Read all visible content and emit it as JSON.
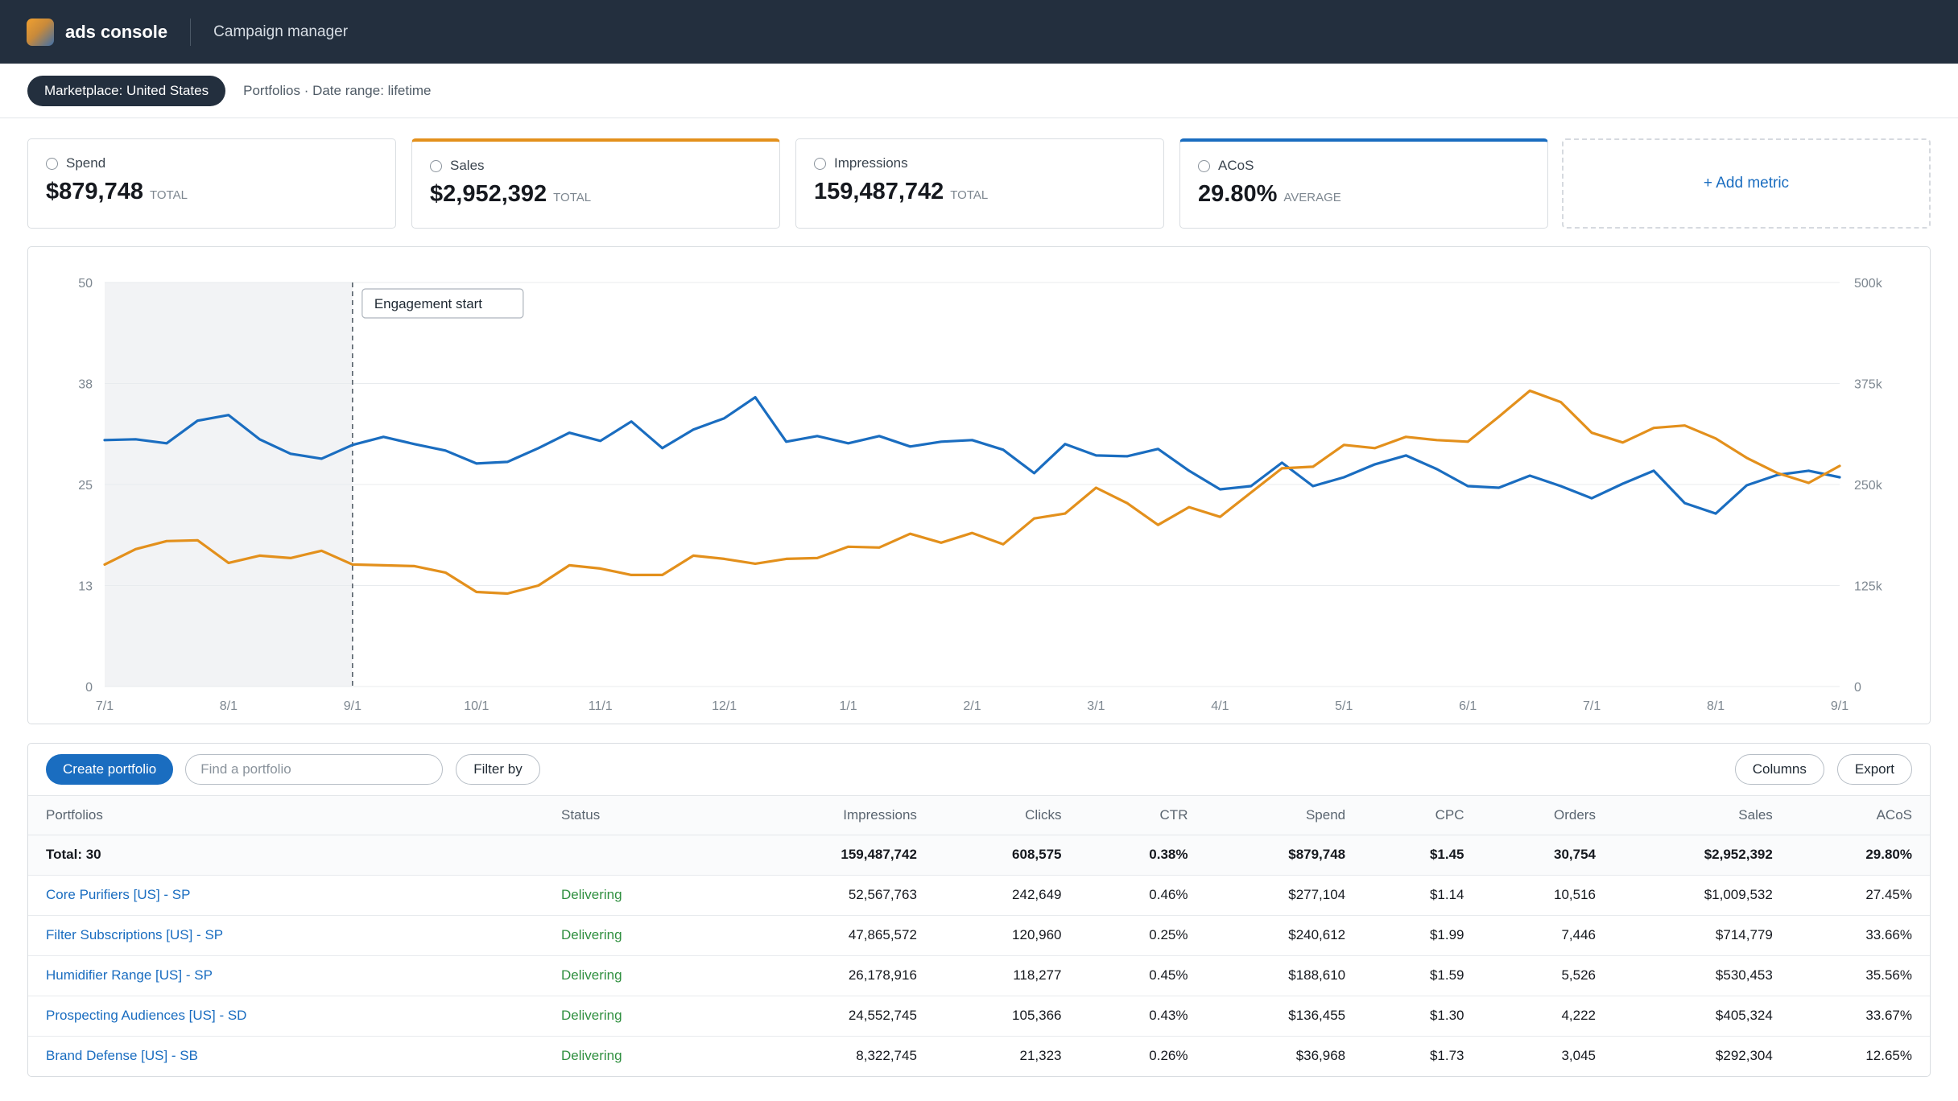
{
  "header": {
    "brand": "ads console",
    "app_name": "Campaign manager"
  },
  "subbar": {
    "marketplace": "Marketplace: United States",
    "crumb": "Portfolios · Date range: lifetime"
  },
  "metrics": [
    {
      "label": "Spend",
      "value": "$879,748",
      "unit": "TOTAL",
      "accent": "none"
    },
    {
      "label": "Sales",
      "value": "$2,952,392",
      "unit": "TOTAL",
      "accent": "#e3901c"
    },
    {
      "label": "Impressions",
      "value": "159,487,742",
      "unit": "TOTAL",
      "accent": "none"
    },
    {
      "label": "ACoS",
      "value": "29.80%",
      "unit": "AVERAGE",
      "accent": "#1a6dc0"
    }
  ],
  "add_metric_label": "+ Add metric",
  "chart_data": {
    "type": "line",
    "annotation": "Engagement start",
    "annotation_x": "9/1",
    "shaded_range": [
      "7/1",
      "9/1"
    ],
    "x_tick_labels": [
      "7/1",
      "8/1",
      "9/1",
      "10/1",
      "11/1",
      "12/1",
      "1/1",
      "2/1",
      "3/1",
      "4/1",
      "5/1",
      "6/1",
      "7/1",
      "8/1",
      "9/1"
    ],
    "y_left_ticks": [
      "50",
      "38",
      "25",
      "13",
      "0"
    ],
    "y_right_ticks": [
      "500k",
      "375k",
      "250k",
      "125k",
      "0"
    ],
    "y_left_range": [
      0,
      50
    ],
    "y_right_range": [
      0,
      500000
    ],
    "series": [
      {
        "axis": "left",
        "color": "#1a6dc0",
        "values": [
          30.5,
          30.6,
          30.1,
          32.9,
          33.6,
          30.6,
          28.8,
          28.2,
          29.9,
          30.9,
          30.0,
          29.2,
          27.6,
          27.8,
          29.5,
          31.4,
          30.4,
          32.8,
          29.5,
          31.8,
          33.2,
          35.8,
          30.3,
          31.0,
          30.1,
          31.0,
          29.7,
          30.3,
          30.5,
          29.3,
          26.4,
          30.0,
          28.6,
          28.5,
          29.4,
          26.7,
          24.4,
          24.8,
          27.7,
          24.8,
          25.9,
          27.5,
          28.6,
          26.9,
          24.8,
          24.6,
          26.1,
          24.8,
          23.3,
          25.1,
          26.7,
          22.7,
          21.4,
          24.9,
          26.2,
          26.7,
          25.9
        ]
      },
      {
        "axis": "right",
        "color": "#e3901c",
        "values": [
          151000,
          170000,
          180000,
          181000,
          153000,
          162000,
          159000,
          168000,
          151000,
          150000,
          149000,
          141000,
          117000,
          115000,
          125000,
          150000,
          146000,
          138000,
          138000,
          162000,
          158000,
          152000,
          158000,
          159000,
          173000,
          172000,
          189000,
          178000,
          190000,
          176000,
          208000,
          214000,
          246000,
          227000,
          200000,
          222000,
          210000,
          240000,
          270000,
          272000,
          299000,
          295000,
          309000,
          305000,
          303000,
          334000,
          366000,
          352000,
          314000,
          302000,
          320000,
          323000,
          307000,
          283000,
          264000,
          252000,
          273000
        ]
      }
    ]
  },
  "table": {
    "toolbar": {
      "create_label": "Create portfolio",
      "search_placeholder": "Find a portfolio",
      "filter_label": "Filter by",
      "columns_label": "Columns",
      "export_label": "Export"
    },
    "columns": [
      "Portfolios",
      "Status",
      "Impressions",
      "Clicks",
      "CTR",
      "Spend",
      "CPC",
      "Orders",
      "Sales",
      "ACoS"
    ],
    "total": [
      "Total: 30",
      "",
      "159,487,742",
      "608,575",
      "0.38%",
      "$879,748",
      "$1.45",
      "30,754",
      "$2,952,392",
      "29.80%"
    ],
    "rows": [
      [
        "Core Purifiers [US] - SP",
        "Delivering",
        "52,567,763",
        "242,649",
        "0.46%",
        "$277,104",
        "$1.14",
        "10,516",
        "$1,009,532",
        "27.45%"
      ],
      [
        "Filter Subscriptions [US] - SP",
        "Delivering",
        "47,865,572",
        "120,960",
        "0.25%",
        "$240,612",
        "$1.99",
        "7,446",
        "$714,779",
        "33.66%"
      ],
      [
        "Humidifier Range [US] - SP",
        "Delivering",
        "26,178,916",
        "118,277",
        "0.45%",
        "$188,610",
        "$1.59",
        "5,526",
        "$530,453",
        "35.56%"
      ],
      [
        "Prospecting Audiences [US] - SD",
        "Delivering",
        "24,552,745",
        "105,366",
        "0.43%",
        "$136,455",
        "$1.30",
        "4,222",
        "$405,324",
        "33.67%"
      ],
      [
        "Brand Defense [US] - SB",
        "Delivering",
        "8,322,745",
        "21,323",
        "0.26%",
        "$36,968",
        "$1.73",
        "3,045",
        "$292,304",
        "12.65%"
      ]
    ]
  }
}
